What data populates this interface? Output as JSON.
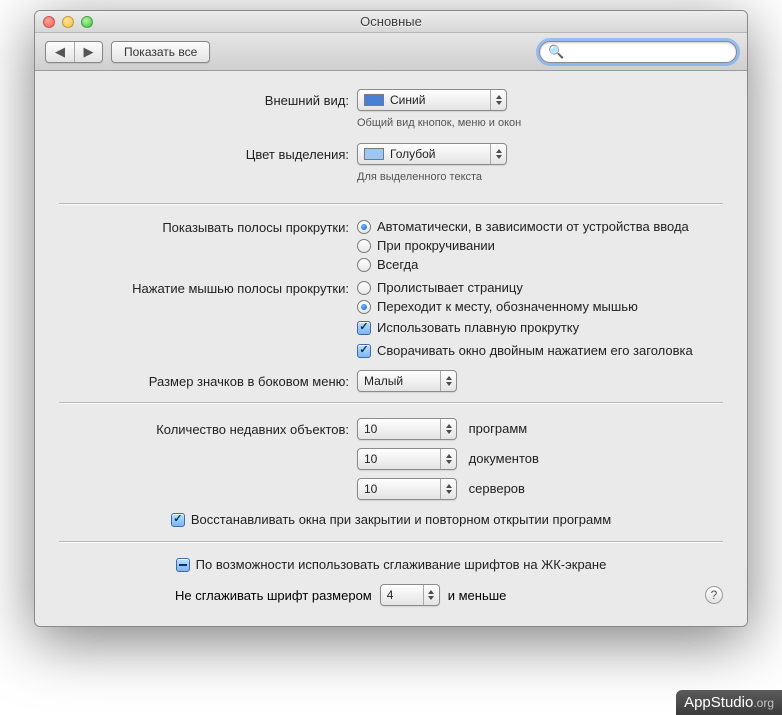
{
  "window": {
    "title": "Основные"
  },
  "toolbar": {
    "show_all": "Показать все",
    "search_placeholder": ""
  },
  "appearance": {
    "label": "Внешний вид:",
    "value": "Синий",
    "hint": "Общий вид кнопок, меню и окон"
  },
  "highlight": {
    "label": "Цвет выделения:",
    "value": "Голубой",
    "hint": "Для выделенного текста"
  },
  "scrollbars": {
    "label": "Показывать полосы прокрутки:",
    "opt1": "Автоматически, в зависимости от устройства ввода",
    "opt2": "При прокручивании",
    "opt3": "Всегда"
  },
  "scrollclick": {
    "label": "Нажатие мышью полосы прокрутки:",
    "opt1": "Пролистывает страницу",
    "opt2": "Переходит к месту, обозначенному мышью"
  },
  "smooth_scroll": "Использовать плавную прокрутку",
  "dblclick_minimize": "Сворачивать окно двойным нажатием его заголовка",
  "sidebar_icons": {
    "label": "Размер значков в боковом меню:",
    "value": "Малый"
  },
  "recent": {
    "label": "Количество недавних объектов:",
    "apps_value": "10",
    "apps_unit": "программ",
    "docs_value": "10",
    "docs_unit": "документов",
    "servers_value": "10",
    "servers_unit": "серверов"
  },
  "restore_windows": "Восстанавливать окна при закрытии и повторном открытии программ",
  "lcd_smoothing": "По возможности использовать сглаживание шрифтов на ЖК-экране",
  "no_smooth": {
    "prefix": "Не сглаживать шрифт размером",
    "value": "4",
    "suffix": "и меньше"
  },
  "watermark": {
    "name": "AppStudio",
    "suffix": ".org"
  }
}
